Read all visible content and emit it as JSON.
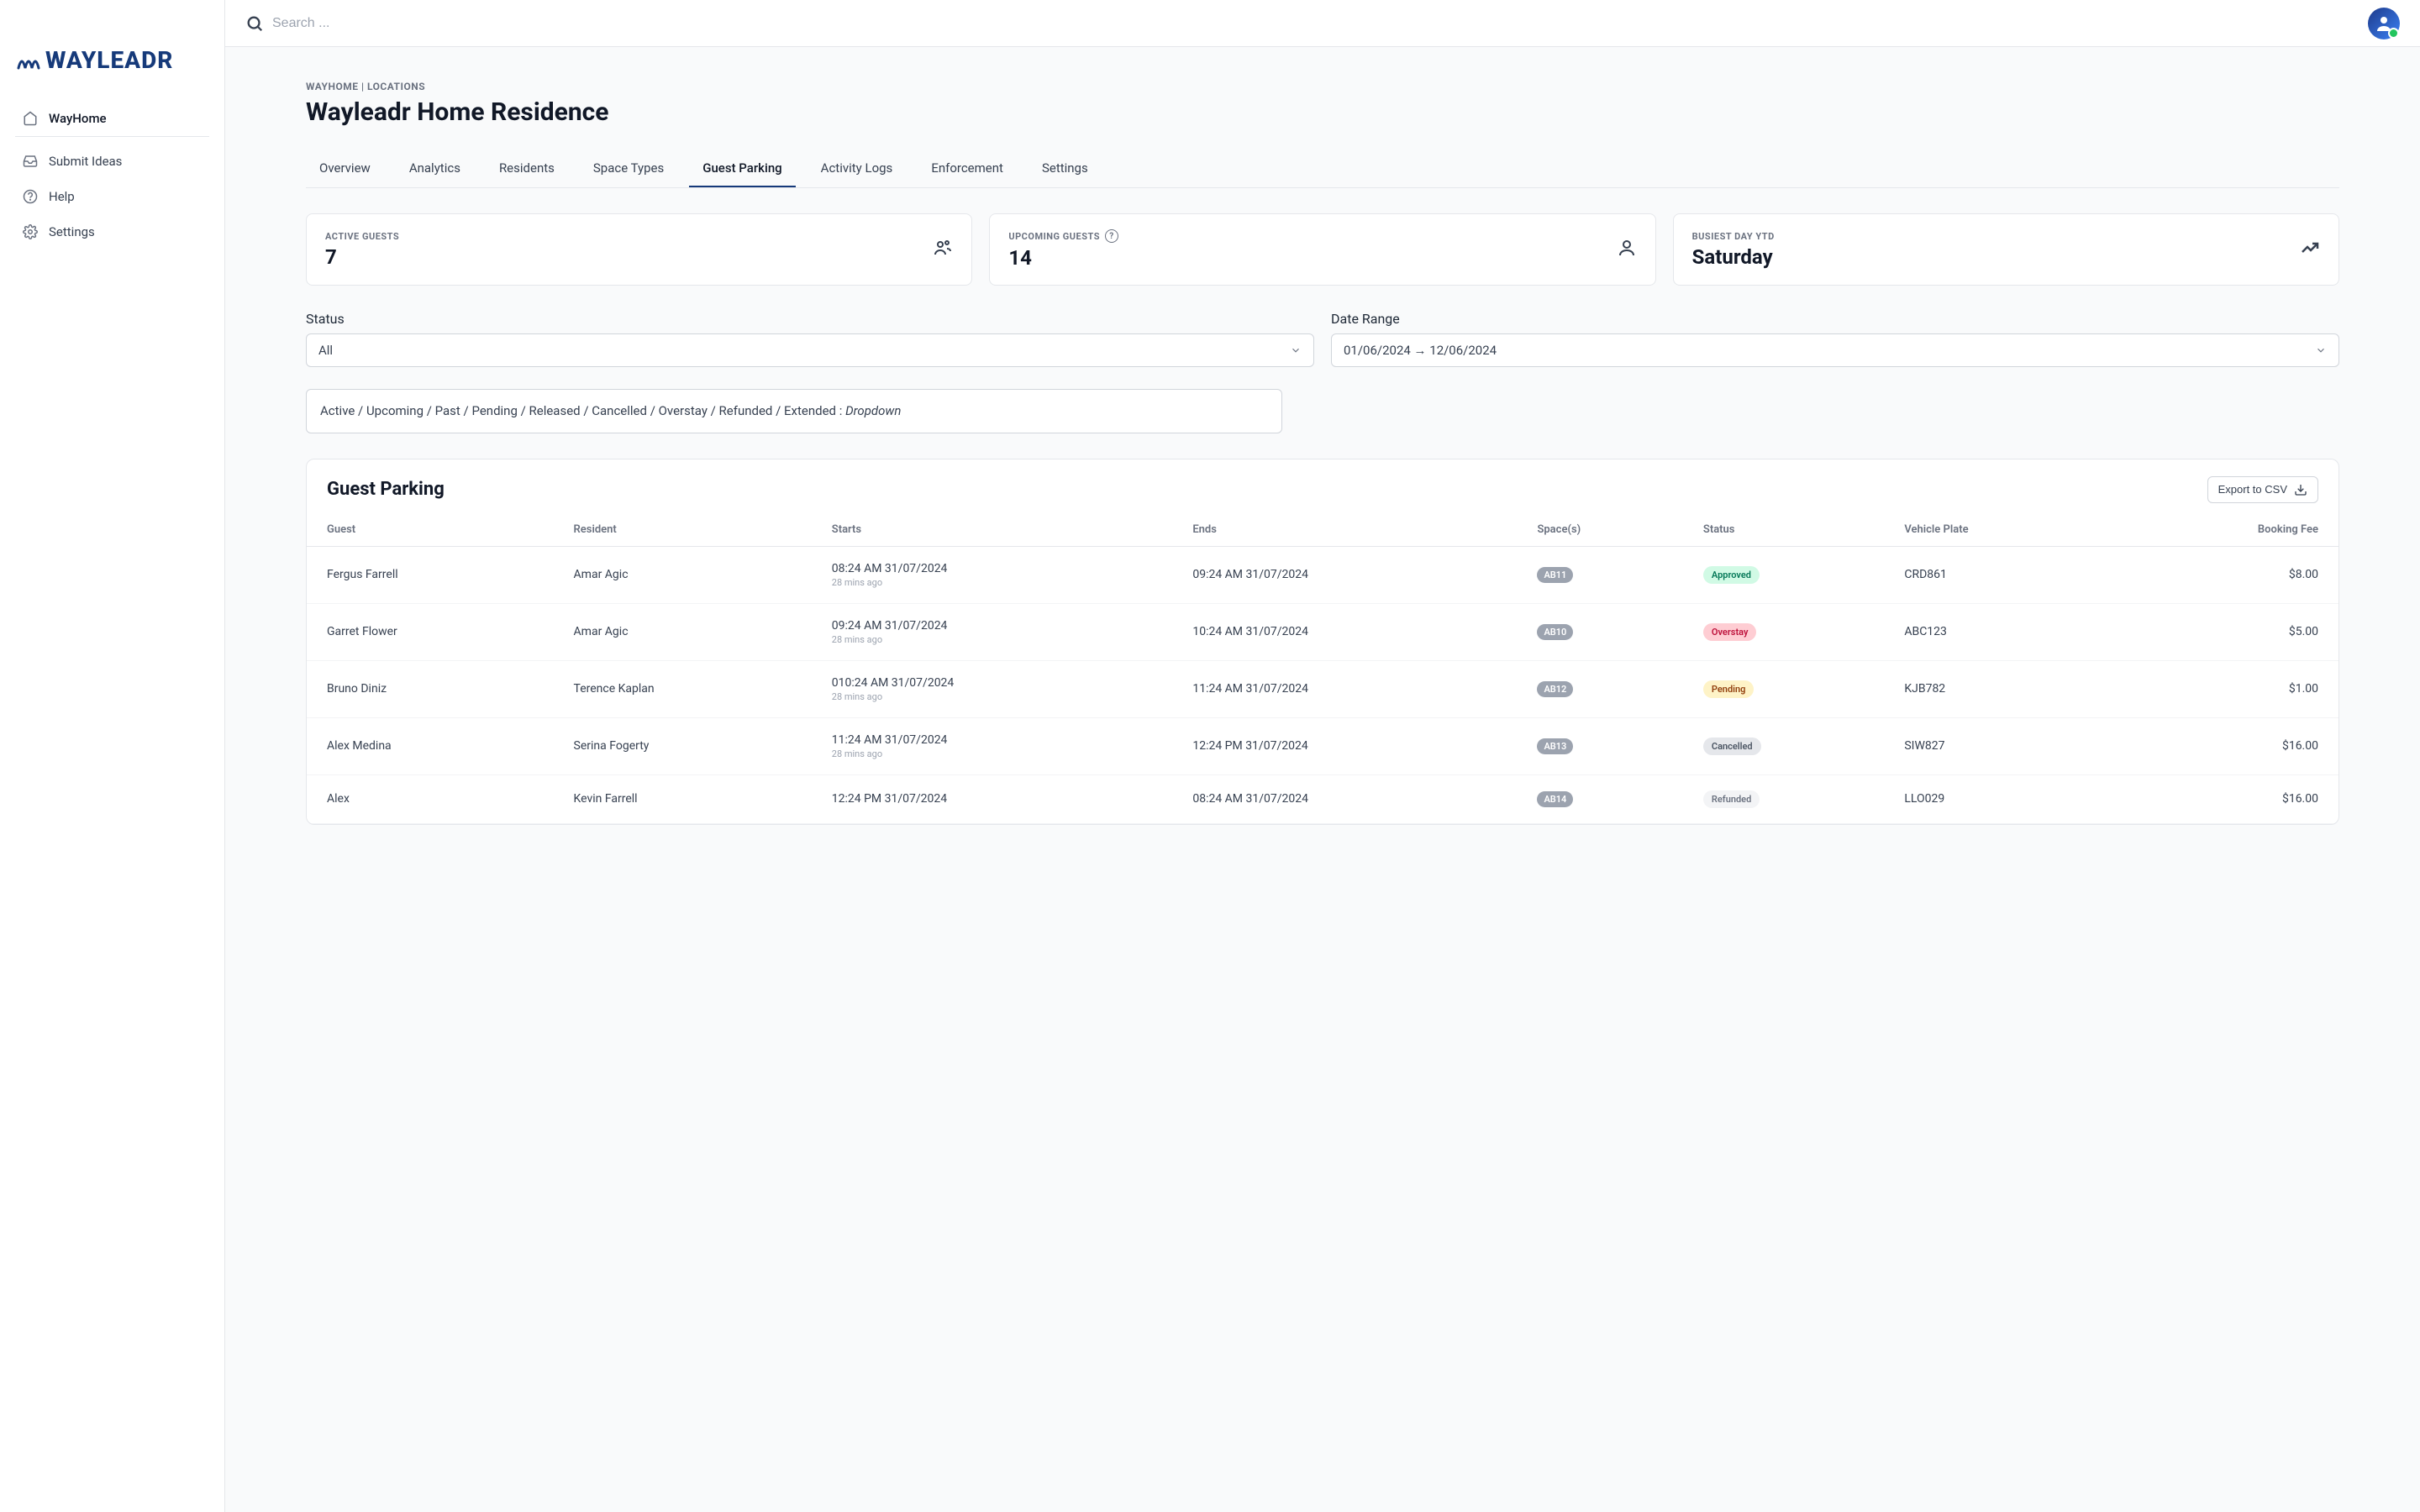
{
  "brand": "WAYLEADR",
  "sidebar": {
    "items": [
      {
        "label": "WayHome",
        "icon": "home-icon"
      },
      {
        "label": "Submit Ideas",
        "icon": "inbox-icon"
      },
      {
        "label": "Help",
        "icon": "help-icon"
      },
      {
        "label": "Settings",
        "icon": "gear-icon"
      }
    ]
  },
  "search": {
    "placeholder": "Search ..."
  },
  "breadcrumb": "WAYHOME | LOCATIONS",
  "page_title": "Wayleadr Home Residence",
  "tabs": [
    {
      "label": "Overview"
    },
    {
      "label": "Analytics"
    },
    {
      "label": "Residents"
    },
    {
      "label": "Space Types"
    },
    {
      "label": "Guest Parking",
      "active": true
    },
    {
      "label": "Activity Logs"
    },
    {
      "label": "Enforcement"
    },
    {
      "label": "Settings"
    }
  ],
  "stats": {
    "active_guests": {
      "label": "ACTIVE GUESTS",
      "value": "7"
    },
    "upcoming_guests": {
      "label": "UPCOMING GUESTS",
      "value": "14"
    },
    "busiest_day": {
      "label": "BUSIEST DAY YTD",
      "value": "Saturday"
    }
  },
  "filters": {
    "status": {
      "label": "Status",
      "value": "All"
    },
    "date_range": {
      "label": "Date Range",
      "value": "01/06/2024 → 12/06/2024"
    },
    "note_prefix": "Active / Upcoming / Past / Pending / Released / Cancelled / Overstay / Refunded / Extended : ",
    "note_suffix": "Dropdown"
  },
  "table": {
    "title": "Guest Parking",
    "export_label": "Export to CSV",
    "columns": [
      "Guest",
      "Resident",
      "Starts",
      "Ends",
      "Space(s)",
      "Status",
      "Vehicle Plate",
      "Booking Fee"
    ],
    "rows": [
      {
        "guest": "Fergus Farrell",
        "resident": "Amar Agic",
        "starts": "08:24 AM 31/07/2024",
        "starts_sub": "28 mins ago",
        "ends": "09:24 AM 31/07/2024",
        "space": "AB11",
        "status": "Approved",
        "status_class": "st-approved",
        "plate": "CRD861",
        "fee": "$8.00"
      },
      {
        "guest": "Garret Flower",
        "resident": "Amar Agic",
        "starts": "09:24 AM 31/07/2024",
        "starts_sub": "28 mins ago",
        "ends": "10:24 AM 31/07/2024",
        "space": "AB10",
        "status": "Overstay",
        "status_class": "st-overstay",
        "plate": "ABC123",
        "fee": "$5.00"
      },
      {
        "guest": "Bruno Diniz",
        "resident": "Terence Kaplan",
        "starts": "010:24 AM 31/07/2024",
        "starts_sub": "28 mins ago",
        "ends": "11:24 AM 31/07/2024",
        "space": "AB12",
        "status": "Pending",
        "status_class": "st-pending",
        "plate": "KJB782",
        "fee": "$1.00"
      },
      {
        "guest": "Alex Medina",
        "resident": "Serina Fogerty",
        "starts": "11:24 AM 31/07/2024",
        "starts_sub": "28 mins ago",
        "ends": "12:24 PM 31/07/2024",
        "space": "AB13",
        "status": "Cancelled",
        "status_class": "st-cancelled",
        "plate": "SIW827",
        "fee": "$16.00"
      },
      {
        "guest": "Alex",
        "resident": "Kevin Farrell",
        "starts": "12:24 PM 31/07/2024",
        "starts_sub": "",
        "ends": "08:24 AM 31/07/2024",
        "space": "AB14",
        "status": "Refunded",
        "status_class": "st-refunded",
        "plate": "LLO029",
        "fee": "$16.00"
      }
    ]
  }
}
